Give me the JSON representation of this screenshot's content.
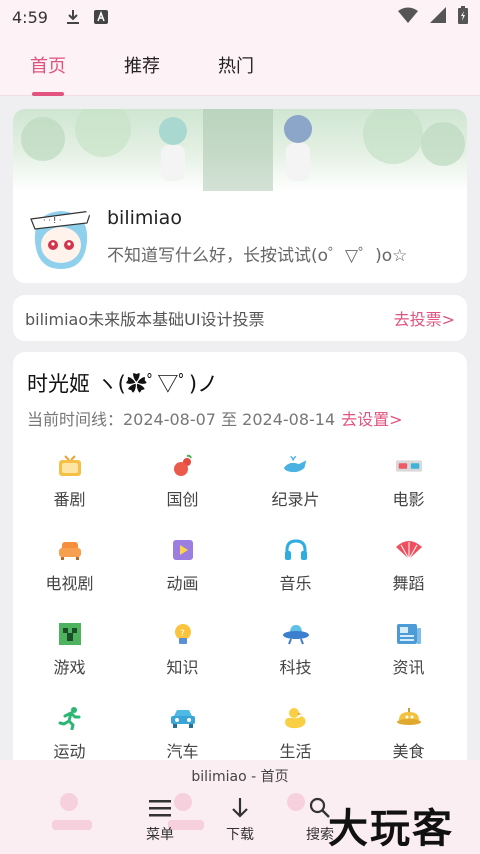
{
  "status_bar": {
    "time": "4:59"
  },
  "tabs": [
    {
      "label": "首页",
      "active": true
    },
    {
      "label": "推荐",
      "active": false
    },
    {
      "label": "热门",
      "active": false
    }
  ],
  "profile": {
    "name": "bilimiao",
    "description": "不知道写什么好，长按试试(o゜▽゜)o☆"
  },
  "vote": {
    "text": "bilimiao未来版本基础UI设计投票",
    "link": "去投票>"
  },
  "timeline": {
    "title": "时光姬  ヽ(✿ﾟ▽ﾟ)ノ",
    "prefix": "当前时间线：2024-08-07 至 2024-08-14",
    "link": "去设置>"
  },
  "categories": [
    {
      "label": "番剧",
      "icon": "tv-icon"
    },
    {
      "label": "国创",
      "icon": "gourd-icon"
    },
    {
      "label": "纪录片",
      "icon": "whale-icon"
    },
    {
      "label": "电影",
      "icon": "3d-glasses-icon"
    },
    {
      "label": "电视剧",
      "icon": "sofa-icon"
    },
    {
      "label": "动画",
      "icon": "play-icon"
    },
    {
      "label": "音乐",
      "icon": "headphones-icon"
    },
    {
      "label": "舞蹈",
      "icon": "fan-icon"
    },
    {
      "label": "游戏",
      "icon": "creeper-icon"
    },
    {
      "label": "知识",
      "icon": "lightbulb-icon"
    },
    {
      "label": "科技",
      "icon": "ufo-icon"
    },
    {
      "label": "资讯",
      "icon": "newspaper-icon"
    },
    {
      "label": "运动",
      "icon": "runner-icon"
    },
    {
      "label": "汽车",
      "icon": "car-icon"
    },
    {
      "label": "生活",
      "icon": "duck-icon"
    },
    {
      "label": "美食",
      "icon": "food-icon"
    }
  ],
  "bottom_bar": {
    "title": "bilimiao - 首页",
    "menu": "菜单",
    "download": "下载",
    "search": "搜索",
    "watermark": "大玩客"
  },
  "colors": {
    "accent": "#e0547f",
    "background": "#efeff1",
    "header_bg": "#fdf2f6"
  }
}
